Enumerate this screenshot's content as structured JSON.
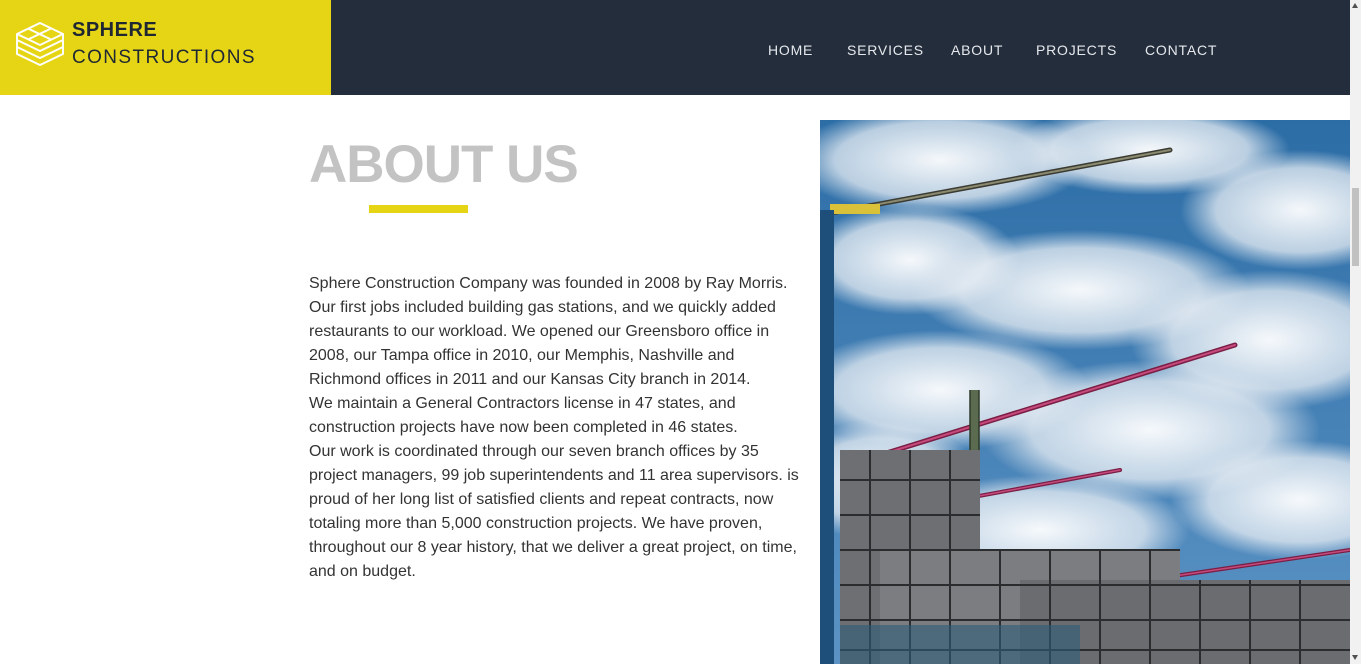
{
  "brand": {
    "line1": "SPHERE",
    "line2": "CONSTRUCTIONS",
    "icon": "layered-cube-logo-icon",
    "accent_color": "#e6d515"
  },
  "nav": {
    "items": [
      {
        "label": "HOME"
      },
      {
        "label": "SERVICES"
      },
      {
        "label": "ABOUT"
      },
      {
        "label": "PROJECTS"
      },
      {
        "label": "CONTACT"
      }
    ]
  },
  "about": {
    "title": "ABOUT US",
    "paragraphs": [
      "Sphere Construction Company was founded in 2008 by Ray Morris. Our first jobs included building gas stations, and we quickly added restaurants to our workload. We opened our Greensboro office in 2008, our Tampa office in 2010, our Memphis, Nashville and Richmond offices in 2011 and our Kansas City branch in 2014.",
      "We maintain a General Contractors license in 47 states, and construction projects have now been completed in 46 states.",
      "Our work is coordinated through our seven branch offices by 35 project managers, 99 job superintendents and 11 area supervisors. is proud of her long list of satisfied clients and repeat contracts, now totaling more than 5,000 construction projects. We have proven, throughout our 8 year history, that we deliver a great project, on time, and on budget."
    ]
  },
  "image": {
    "subject": "construction-cranes-building-sky-photo"
  },
  "colors": {
    "header_bg": "#232d3c",
    "brand_bg": "#e6d515",
    "title_gray": "#c3c3c3"
  }
}
